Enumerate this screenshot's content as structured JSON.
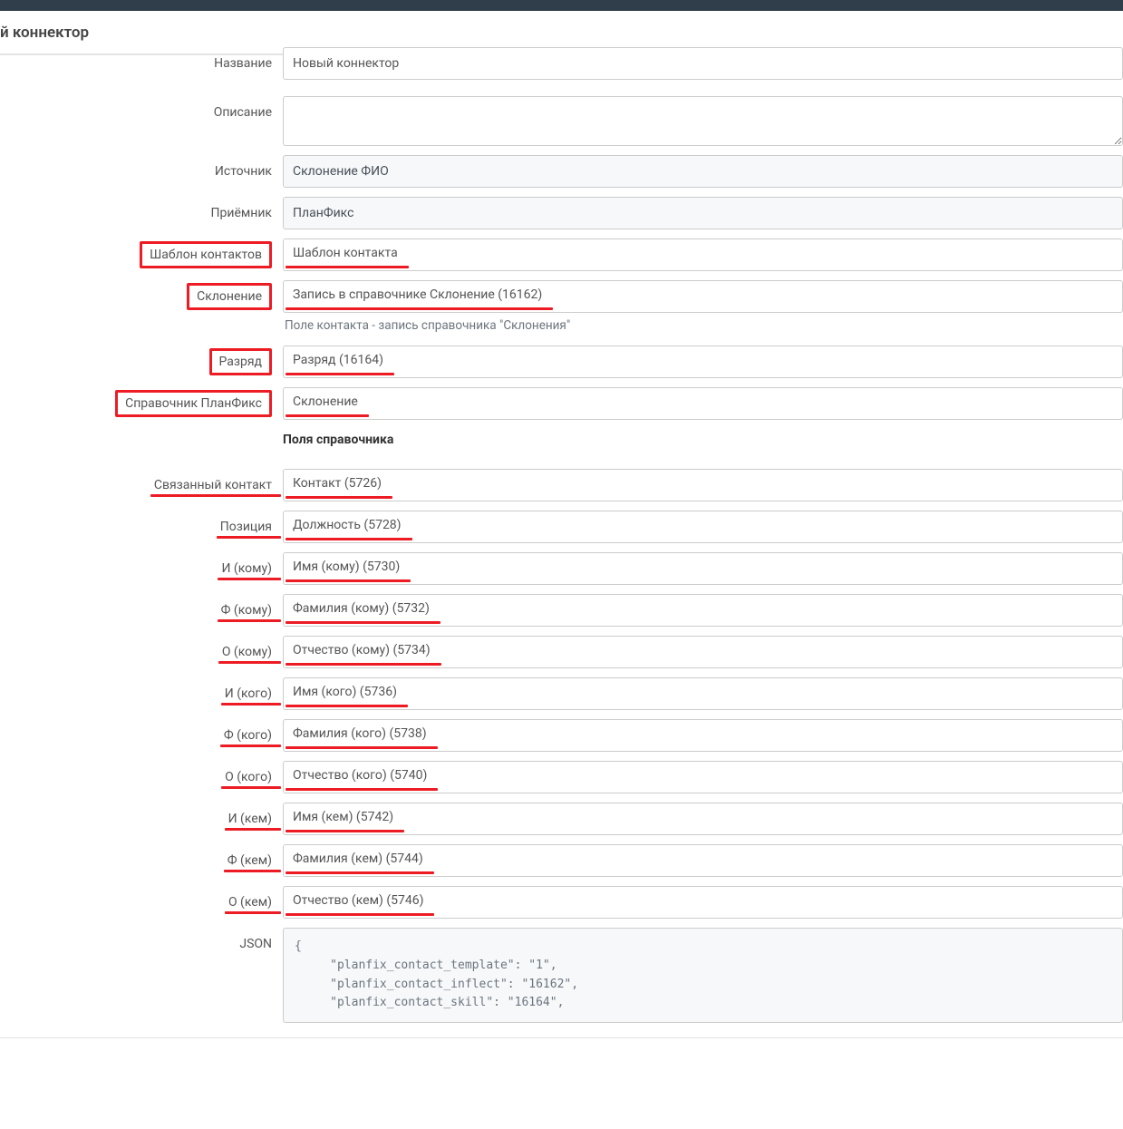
{
  "page": {
    "title": "й коннектор"
  },
  "form": {
    "name": {
      "label": "Название",
      "value": "Новый коннектор"
    },
    "description": {
      "label": "Описание",
      "value": ""
    },
    "source": {
      "label": "Источник",
      "value": "Склонение ФИО"
    },
    "receiver": {
      "label": "Приёмник",
      "value": "ПланФикс"
    },
    "contact_template": {
      "label": "Шаблон контактов",
      "value": "Шаблон контакта"
    },
    "inflection": {
      "label": "Склонение",
      "value": "Запись в справочнике Склонение (16162)",
      "help": "Поле контакта - запись справочника \"Склонения\""
    },
    "rank": {
      "label": "Разряд",
      "value": "Разряд (16164)"
    },
    "directory": {
      "label": "Справочник ПланФикс",
      "value": "Склонение"
    },
    "section": "Поля справочника",
    "linked_contact": {
      "label": "Связанный контакт",
      "value": "Контакт (5726)"
    },
    "position": {
      "label": "Позиция",
      "value": "Должность (5728)"
    },
    "i_komu": {
      "label": "И (кому)",
      "value": "Имя (кому) (5730)"
    },
    "f_komu": {
      "label": "Ф (кому)",
      "value": "Фамилия (кому) (5732)"
    },
    "o_komu": {
      "label": "О (кому)",
      "value": "Отчество (кому) (5734)"
    },
    "i_kogo": {
      "label": "И (кого)",
      "value": "Имя (кого) (5736)"
    },
    "f_kogo": {
      "label": "Ф (кого)",
      "value": "Фамилия (кого) (5738)"
    },
    "o_kogo": {
      "label": "О (кого)",
      "value": "Отчество (кого) (5740)"
    },
    "i_kem": {
      "label": "И (кем)",
      "value": "Имя (кем) (5742)"
    },
    "f_kem": {
      "label": "Ф (кем)",
      "value": "Фамилия (кем) (5744)"
    },
    "o_kem": {
      "label": "О (кем)",
      "value": "Отчество (кем) (5746)"
    },
    "json": {
      "label": "JSON",
      "value": "{\n     \"planfix_contact_template\": \"1\",\n     \"planfix_contact_inflect\": \"16162\",\n     \"planfix_contact_skill\": \"16164\","
    }
  }
}
